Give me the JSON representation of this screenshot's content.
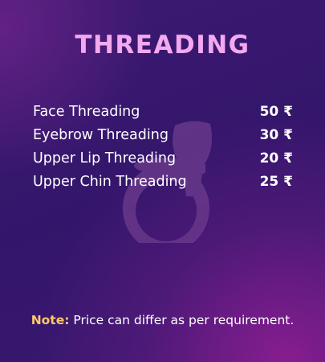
{
  "title": "THREADING",
  "services": [
    {
      "name": "Face Threading",
      "price": "50 ₹"
    },
    {
      "name": "Eyebrow Threading",
      "price": "30 ₹"
    },
    {
      "name": "Upper Lip Threading",
      "price": "20 ₹"
    },
    {
      "name": "Upper Chin Threading",
      "price": "25 ₹"
    }
  ],
  "note": {
    "label": "Note:",
    "text": "Price can differ as per requirement."
  },
  "colors": {
    "title": "#f4a9ef",
    "note_label": "#ffc969",
    "background": "#3a1870"
  },
  "background_icon": "makeup-brush-compact-icon"
}
